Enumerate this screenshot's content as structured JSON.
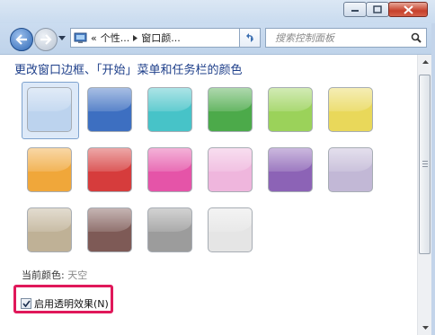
{
  "window": {
    "minimize_icon": "minimize-icon",
    "maximize_icon": "maximize-icon",
    "close_icon": "close-icon"
  },
  "nav": {
    "address": {
      "prefix": "«",
      "crumb1": "个性...",
      "crumb2": "窗口颜..."
    },
    "search_placeholder": "搜索控制面板"
  },
  "page": {
    "heading": "更改窗口边框、「开始」菜单和任务栏的颜色",
    "current_color_label": "当前颜色:",
    "current_color_value": "天空",
    "transparency_label": "启用透明效果(N)",
    "transparency_checked": true
  },
  "swatches": [
    {
      "color": "#bcd3ee",
      "selected": true
    },
    {
      "color": "#3d6fc1",
      "selected": false
    },
    {
      "color": "#47c3c8",
      "selected": false
    },
    {
      "color": "#4caa4a",
      "selected": false
    },
    {
      "color": "#9bd25a",
      "selected": false
    },
    {
      "color": "#e9d85a",
      "selected": false
    },
    {
      "color": "#f0a73a",
      "selected": false
    },
    {
      "color": "#d63c3c",
      "selected": false
    },
    {
      "color": "#e554a8",
      "selected": false
    },
    {
      "color": "#efb6dd",
      "selected": false
    },
    {
      "color": "#8c63b6",
      "selected": false
    },
    {
      "color": "#c2b8d6",
      "selected": false
    },
    {
      "color": "#bfb196",
      "selected": false
    },
    {
      "color": "#7e5a56",
      "selected": false
    },
    {
      "color": "#9c9c9c",
      "selected": false
    },
    {
      "color": "#e5e5e5",
      "selected": false
    }
  ],
  "accent": {
    "highlight_color": "#e0185a",
    "heading_color": "#1e3f8a"
  }
}
